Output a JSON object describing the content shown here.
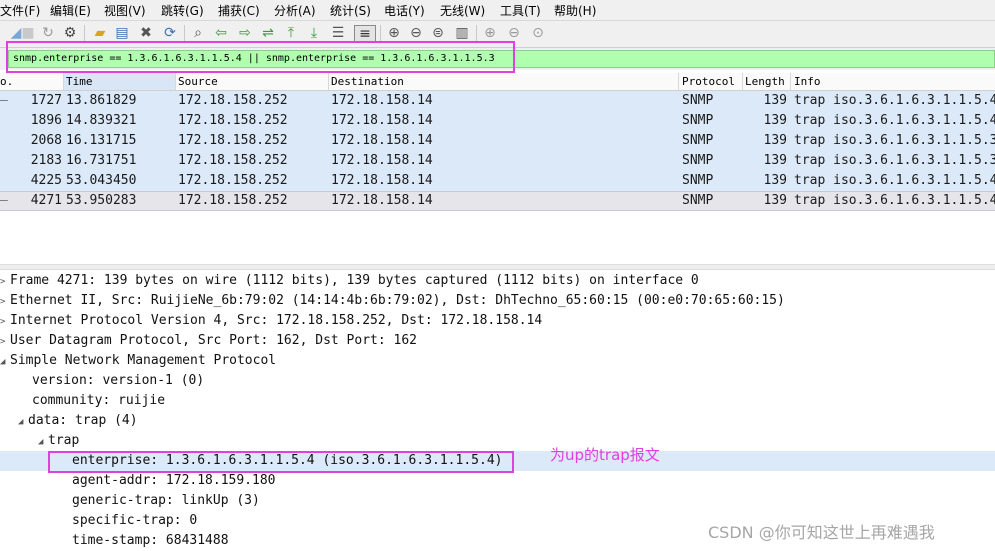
{
  "menubar": {
    "items": [
      "文件(F)",
      "编辑(E)",
      "视图(V)",
      "跳转(G)",
      "捕获(C)",
      "分析(A)",
      "统计(S)",
      "电话(Y)",
      "无线(W)",
      "工具(T)",
      "帮助(H)"
    ]
  },
  "toolbar": {
    "icons": [
      "shark-fin-icon",
      "stop-icon",
      "restart-icon",
      "options-gear-icon",
      "open-folder-icon",
      "save-file-icon",
      "close-file-icon",
      "reload-icon",
      "find-icon",
      "back-arrow-icon",
      "forward-arrow-icon",
      "goto-packet-icon",
      "first-packet-icon",
      "last-packet-icon",
      "autoscroll-icon",
      "colorize-icon",
      "zoom-in-icon",
      "zoom-out-icon",
      "zoom-normal-icon",
      "resize-columns-icon"
    ]
  },
  "filter": {
    "value": "snmp.enterprise == 1.3.6.1.6.3.1.1.5.4  || snmp.enterprise == 1.3.6.1.6.3.1.1.5.3"
  },
  "columns": {
    "no": "o.",
    "time": "Time",
    "source": "Source",
    "destination": "Destination",
    "protocol": "Protocol",
    "length": "Length",
    "info": "Info"
  },
  "packets": [
    {
      "marker": "—",
      "no": "1727",
      "time": "13.861829",
      "source": "172.18.158.252",
      "destination": "172.18.158.14",
      "protocol": "SNMP",
      "length": "139",
      "info": "trap iso.3.6.1.6.3.1.1.5.4"
    },
    {
      "marker": "",
      "no": "1896",
      "time": "14.839321",
      "source": "172.18.158.252",
      "destination": "172.18.158.14",
      "protocol": "SNMP",
      "length": "139",
      "info": "trap iso.3.6.1.6.3.1.1.5.4"
    },
    {
      "marker": "",
      "no": "2068",
      "time": "16.131715",
      "source": "172.18.158.252",
      "destination": "172.18.158.14",
      "protocol": "SNMP",
      "length": "139",
      "info": "trap iso.3.6.1.6.3.1.1.5.3"
    },
    {
      "marker": "",
      "no": "2183",
      "time": "16.731751",
      "source": "172.18.158.252",
      "destination": "172.18.158.14",
      "protocol": "SNMP",
      "length": "139",
      "info": "trap iso.3.6.1.6.3.1.1.5.3"
    },
    {
      "marker": "",
      "no": "4225",
      "time": "53.043450",
      "source": "172.18.158.252",
      "destination": "172.18.158.14",
      "protocol": "SNMP",
      "length": "139",
      "info": "trap iso.3.6.1.6.3.1.1.5.4"
    },
    {
      "marker": "—",
      "no": "4271",
      "time": "53.950283",
      "source": "172.18.158.252",
      "destination": "172.18.158.14",
      "protocol": "SNMP",
      "length": "139",
      "info": "trap iso.3.6.1.6.3.1.1.5.4"
    }
  ],
  "details": [
    {
      "arrow": ">",
      "text": "Frame 4271: 139 bytes on wire (1112 bits), 139 bytes captured (1112 bits) on interface 0"
    },
    {
      "arrow": ">",
      "text": "Ethernet II, Src: RuijieNe_6b:79:02 (14:14:4b:6b:79:02), Dst: DhTechno_65:60:15 (00:e0:70:65:60:15)"
    },
    {
      "arrow": ">",
      "text": "Internet Protocol Version 4, Src: 172.18.158.252, Dst: 172.18.158.14"
    },
    {
      "arrow": ">",
      "text": "User Datagram Protocol, Src Port: 162, Dst Port: 162"
    },
    {
      "arrow": "◢",
      "text": "Simple Network Management Protocol"
    },
    {
      "arrow": "",
      "text": "version: version-1 (0)"
    },
    {
      "arrow": "",
      "text": "community: ruijie"
    },
    {
      "arrow": "◢",
      "text": "data: trap (4)"
    },
    {
      "arrow": "◢",
      "text": "trap"
    },
    {
      "arrow": "",
      "text": "enterprise: 1.3.6.1.6.3.1.1.5.4 (iso.3.6.1.6.3.1.1.5.4)"
    },
    {
      "arrow": "",
      "text": "agent-addr: 172.18.159.180"
    },
    {
      "arrow": "",
      "text": "generic-trap: linkUp (3)"
    },
    {
      "arrow": "",
      "text": "specific-trap: 0"
    },
    {
      "arrow": "",
      "text": "time-stamp: 68431488"
    }
  ],
  "annotation": "为up的trap报文",
  "watermark": "CSDN @你可知这世上再难遇我",
  "colors": {
    "filter_bg": "#afffaf",
    "highlight_box": "#e040e0",
    "row_bg": "#dbe9f8"
  }
}
